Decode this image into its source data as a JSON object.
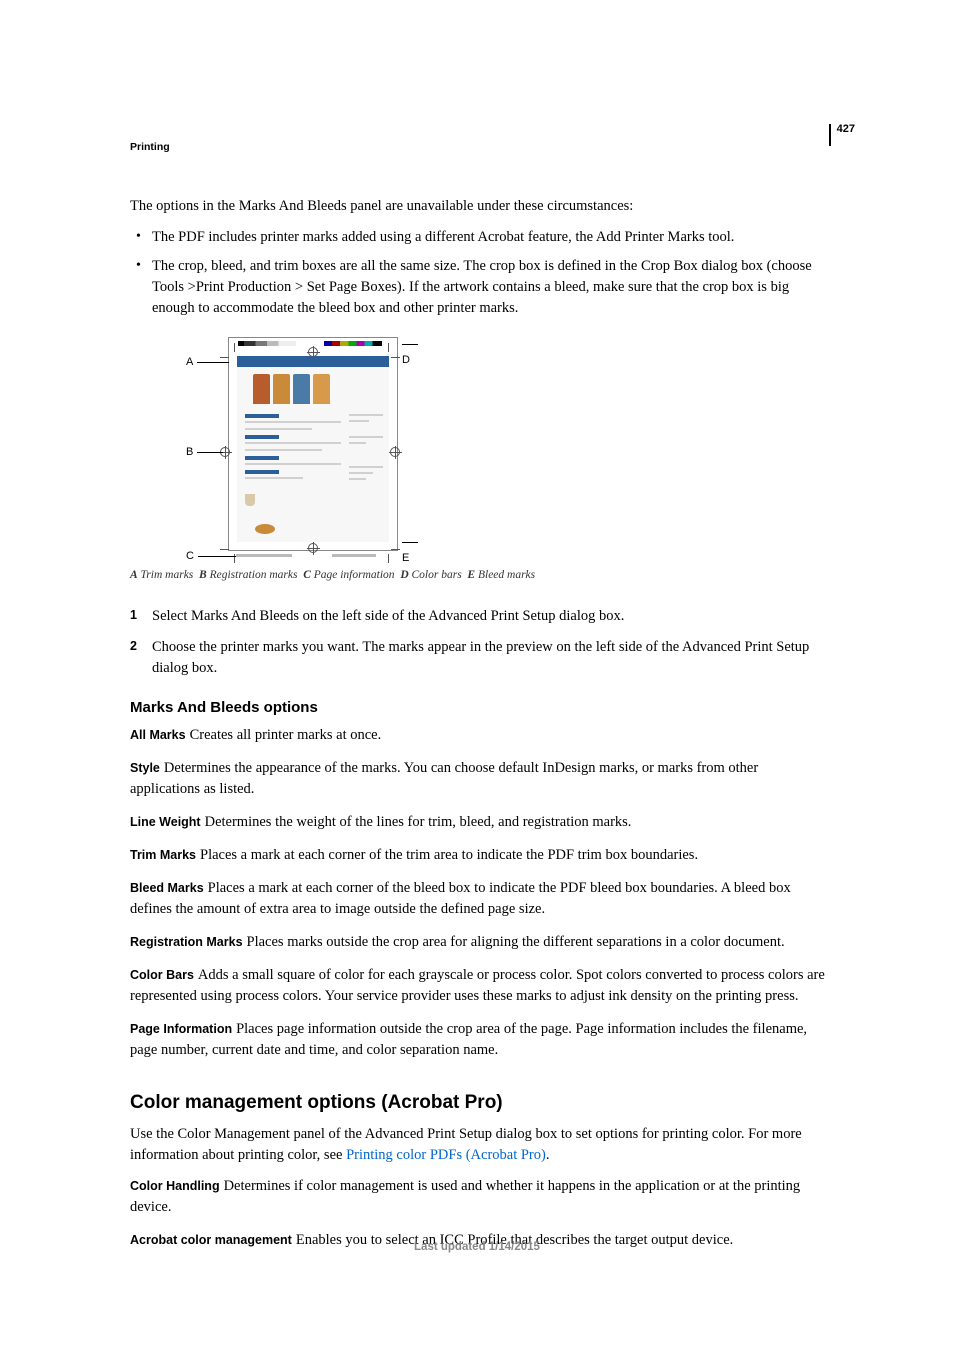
{
  "page_number": "427",
  "section_header": "Printing",
  "intro": "The options in the Marks And Bleeds panel are unavailable under these circumstances:",
  "bullets": [
    "The PDF includes printer marks added using a different Acrobat feature, the Add Printer Marks tool.",
    "The crop, bleed, and trim boxes are all the same size. The crop box is defined in the Crop Box dialog box (choose Tools >Print Production > Set Page Boxes). If the artwork contains a bleed, make sure that the crop box is big enough to accommodate the bleed box and other printer marks."
  ],
  "figure_keys": {
    "A": "A",
    "B": "B",
    "C": "C",
    "D": "D",
    "E": "E"
  },
  "caption_parts": {
    "A": "A",
    "A_txt": "Trim marks",
    "B": "B",
    "B_txt": "Registration marks",
    "C": "C",
    "C_txt": "Page information",
    "D": "D",
    "D_txt": "Color bars",
    "E": "E",
    "E_txt": "Bleed marks"
  },
  "steps": [
    "Select Marks And Bleeds on the left side of the Advanced Print Setup dialog box.",
    "Choose the printer marks you want. The marks appear in the preview on the left side of the Advanced Print Setup dialog box."
  ],
  "step_nums": [
    "1",
    "2"
  ],
  "h3_marks": "Marks And Bleeds options",
  "defs": {
    "all_marks": {
      "term": "All Marks",
      "text": "Creates all printer marks at once."
    },
    "style": {
      "term": "Style",
      "text": "Determines the appearance of the marks. You can choose default InDesign marks, or marks from other applications as listed."
    },
    "line_weight": {
      "term": "Line Weight",
      "text": "Determines the weight of the lines for trim, bleed, and registration marks."
    },
    "trim_marks": {
      "term": "Trim Marks",
      "text": "Places a mark at each corner of the trim area to indicate the PDF trim box boundaries."
    },
    "bleed_marks": {
      "term": "Bleed Marks",
      "text": "Places a mark at each corner of the bleed box to indicate the PDF bleed box boundaries. A bleed box defines the amount of extra area to image outside the defined page size."
    },
    "registration_marks": {
      "term": "Registration Marks",
      "text": "Places marks outside the crop area for aligning the different separations in a color document."
    },
    "color_bars": {
      "term": "Color Bars",
      "text": "Adds a small square of color for each grayscale or process color. Spot colors converted to process colors are represented using process colors. Your service provider uses these marks to adjust ink density on the printing press."
    },
    "page_information": {
      "term": "Page Information",
      "text": "Places page information outside the crop area of the page. Page information includes the filename, page number, current date and time, and color separation name."
    }
  },
  "h2_color": "Color management options (Acrobat Pro)",
  "color_intro_pre": "Use the Color Management panel of the Advanced Print Setup dialog box to set options for printing color. For more information about printing color, see ",
  "color_intro_link": "Printing color PDFs (Acrobat Pro)",
  "color_intro_post": ".",
  "color_defs": {
    "color_handling": {
      "term": "Color Handling",
      "text": "Determines if color management is used and whether it happens in the application or at the printing device."
    },
    "acrobat_color": {
      "term": "Acrobat color management",
      "text": "Enables you to select an ICC Profile that describes the target output device."
    }
  },
  "footer": "Last updated 1/14/2015"
}
